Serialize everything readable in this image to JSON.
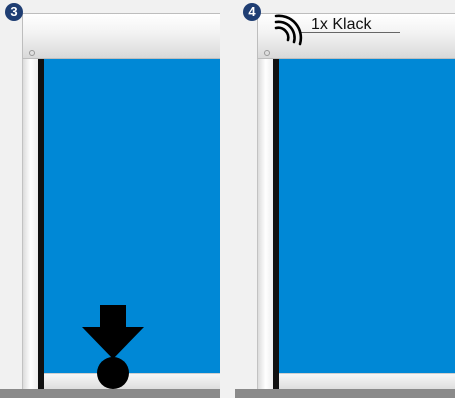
{
  "steps": [
    {
      "number": "3",
      "action": "push-down"
    },
    {
      "number": "4",
      "sound_label": "1x Klack"
    }
  ],
  "colors": {
    "blind": "#0088d6",
    "badge": "#1f3e73",
    "frame": "#e6e6e6",
    "sill": "#8a8a8a",
    "arrow": "#000000"
  },
  "icons": [
    "push-down-arrow-icon",
    "sound-waves-icon"
  ]
}
